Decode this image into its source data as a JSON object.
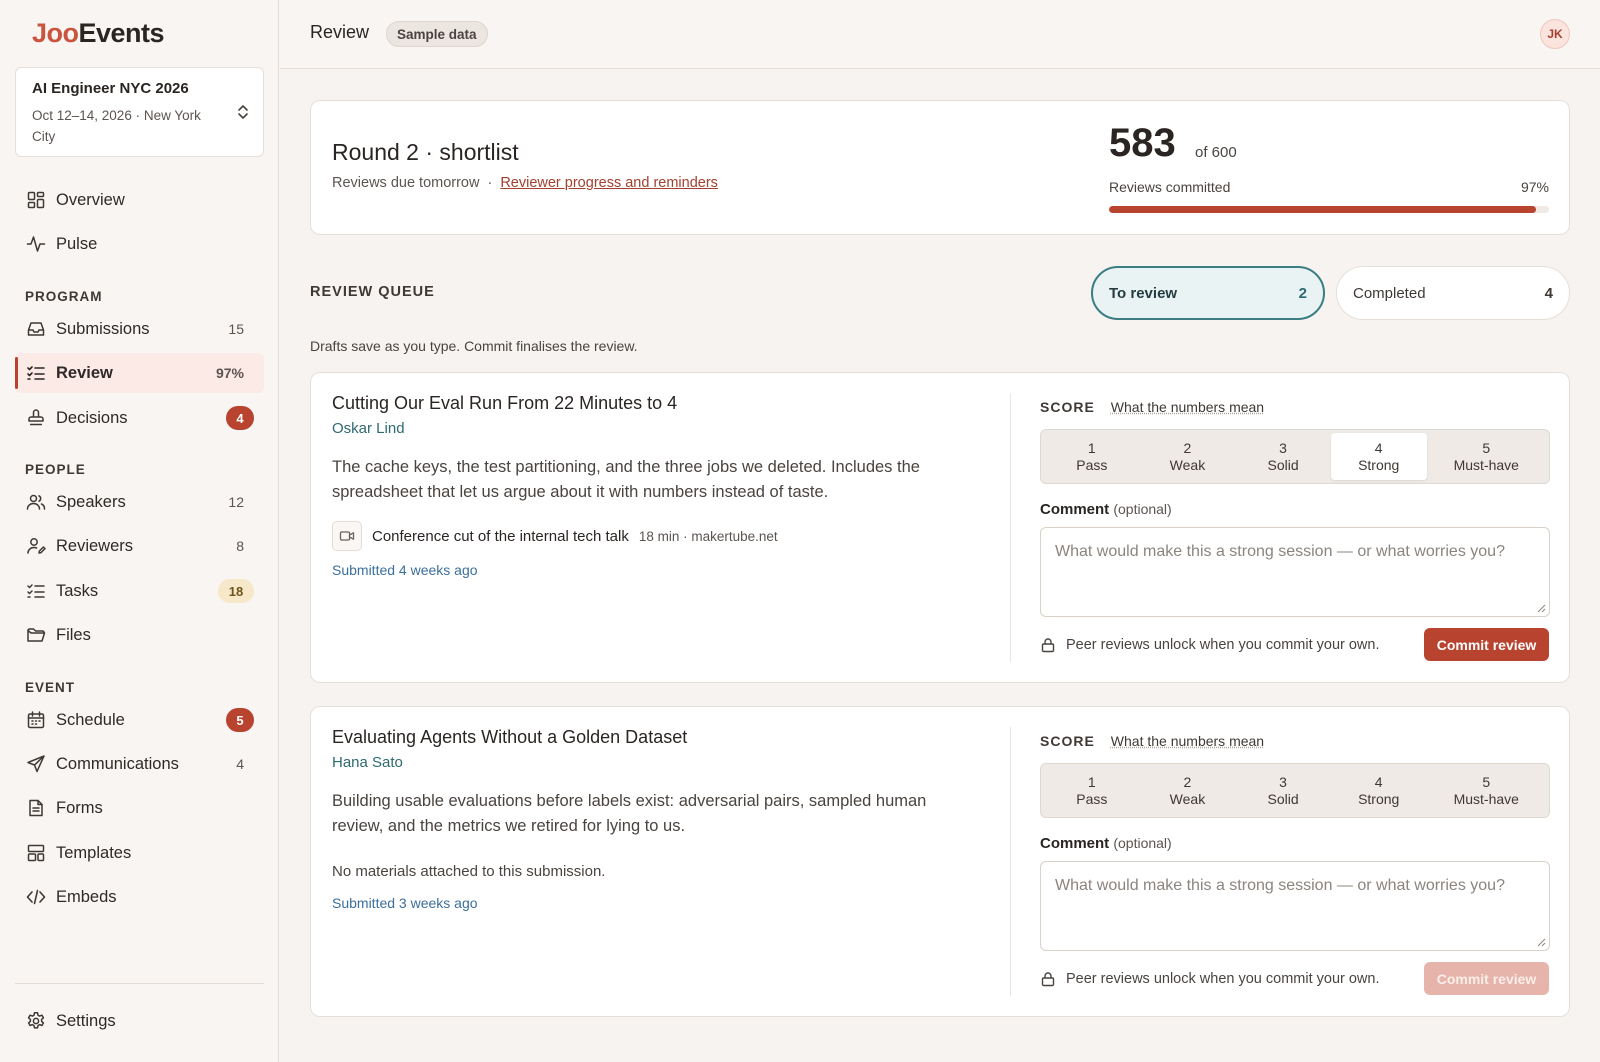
{
  "app": {
    "logo_a": "Joo",
    "logo_b": "Events"
  },
  "event": {
    "name": "AI Engineer NYC 2026",
    "meta": "Oct 12–14, 2026 · New York City"
  },
  "sidebar": {
    "top": [
      {
        "label": "Overview"
      },
      {
        "label": "Pulse"
      }
    ],
    "program_label": "PROGRAM",
    "program": [
      {
        "label": "Submissions",
        "count": "15"
      },
      {
        "label": "Review",
        "count": "97%"
      },
      {
        "label": "Decisions",
        "count": "4"
      }
    ],
    "people_label": "PEOPLE",
    "people": [
      {
        "label": "Speakers",
        "count": "12"
      },
      {
        "label": "Reviewers",
        "count": "8"
      },
      {
        "label": "Tasks",
        "count": "18"
      },
      {
        "label": "Files"
      }
    ],
    "event_label": "EVENT",
    "event": [
      {
        "label": "Schedule",
        "count": "5"
      },
      {
        "label": "Communications",
        "count": "4"
      },
      {
        "label": "Forms"
      },
      {
        "label": "Templates"
      },
      {
        "label": "Embeds"
      }
    ],
    "settings": "Settings"
  },
  "topbar": {
    "title": "Review",
    "pill": "Sample data",
    "avatar": "JK"
  },
  "round": {
    "title": "Round 2 · shortlist",
    "due": "Reviews due tomorrow",
    "separator": "·",
    "link": "Reviewer progress and reminders",
    "committed": "583",
    "of_total": "of 600",
    "committed_label": "Reviews committed",
    "percent_label": "97%",
    "progress_fraction": 0.97
  },
  "queue": {
    "title": "REVIEW QUEUE",
    "tabs": [
      {
        "label": "To review",
        "count": "2"
      },
      {
        "label": "Completed",
        "count": "4"
      }
    ],
    "note": "Drafts save as you type. Commit finalises the review."
  },
  "reviews": [
    {
      "title": "Cutting Our Eval Run From 22 Minutes to 4",
      "author": "Oskar Lind",
      "abstract": "The cache keys, the test partitioning, and the three jobs we deleted. Includes the spreadsheet that let us argue about it with numbers instead of taste.",
      "material_title": "Conference cut of the internal tech talk",
      "material_meta": "18 min · makertube.net",
      "submitted": "Submitted 4 weeks ago",
      "selected_score": 4,
      "commit": "Commit review"
    },
    {
      "title": "Evaluating Agents Without a Golden Dataset",
      "author": "Hana Sato",
      "abstract": "Building usable evaluations before labels exist: adversarial pairs, sampled human review, and the metrics we retired for lying to us.",
      "no_materials": "No materials attached to this submission.",
      "submitted": "Submitted 3 weeks ago",
      "selected_score": null,
      "commit": "Commit review"
    }
  ],
  "score": {
    "label": "SCORE",
    "meaning": "What the numbers mean",
    "options": [
      {
        "n": "1",
        "label": "Pass"
      },
      {
        "n": "2",
        "label": "Weak"
      },
      {
        "n": "3",
        "label": "Solid"
      },
      {
        "n": "4",
        "label": "Strong"
      },
      {
        "n": "5",
        "label": "Must-have"
      }
    ]
  },
  "comment": {
    "label": "Comment",
    "optional": "(optional)",
    "placeholder": "What would make this a strong session — or what worries you?"
  },
  "peer_note": "Peer reviews unlock when you commit your own.",
  "colors": {
    "accent": "#b8432f",
    "teal": "#2d6a70",
    "link_blue": "#3b6f9c"
  }
}
